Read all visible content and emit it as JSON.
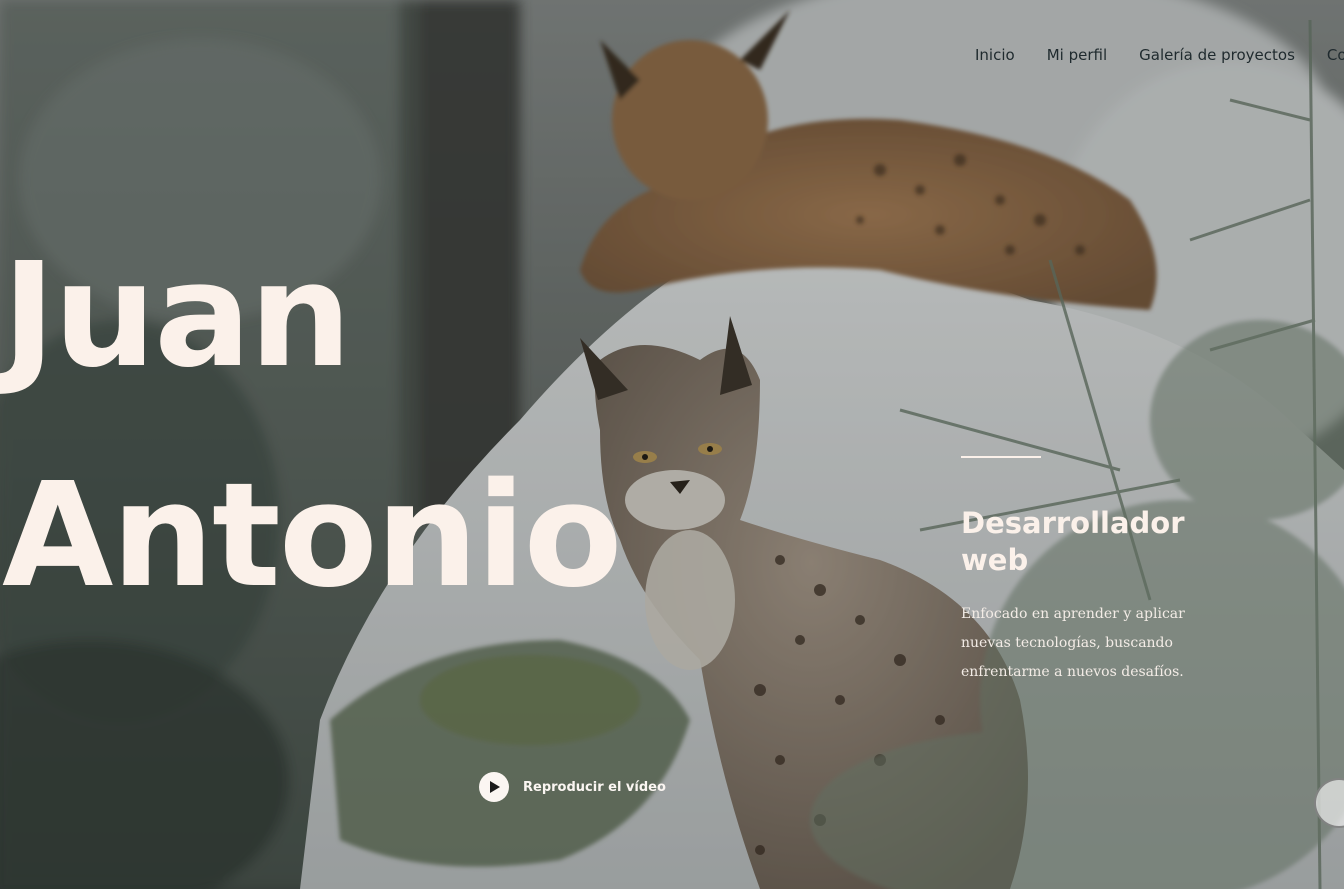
{
  "nav": {
    "items": [
      {
        "label": "Inicio"
      },
      {
        "label": "Mi perfil"
      },
      {
        "label": "Galería de proyectos"
      },
      {
        "label": "Contác"
      }
    ]
  },
  "hero": {
    "title_line1": "Juan",
    "title_line2": "Antonio",
    "subtitle": "Desarrollador web",
    "description": "Enfocado en aprender y aplicar nuevas tecnologías, buscando enfrentarme a nuevos desafíos.",
    "video_label": "Reproducir el vídeo",
    "background_image": "two-lynxes-in-snowy-forest"
  },
  "colors": {
    "headline": "#fbf1ea",
    "nav_text": "#1f2a2e"
  },
  "icons": [
    "play-icon"
  ]
}
